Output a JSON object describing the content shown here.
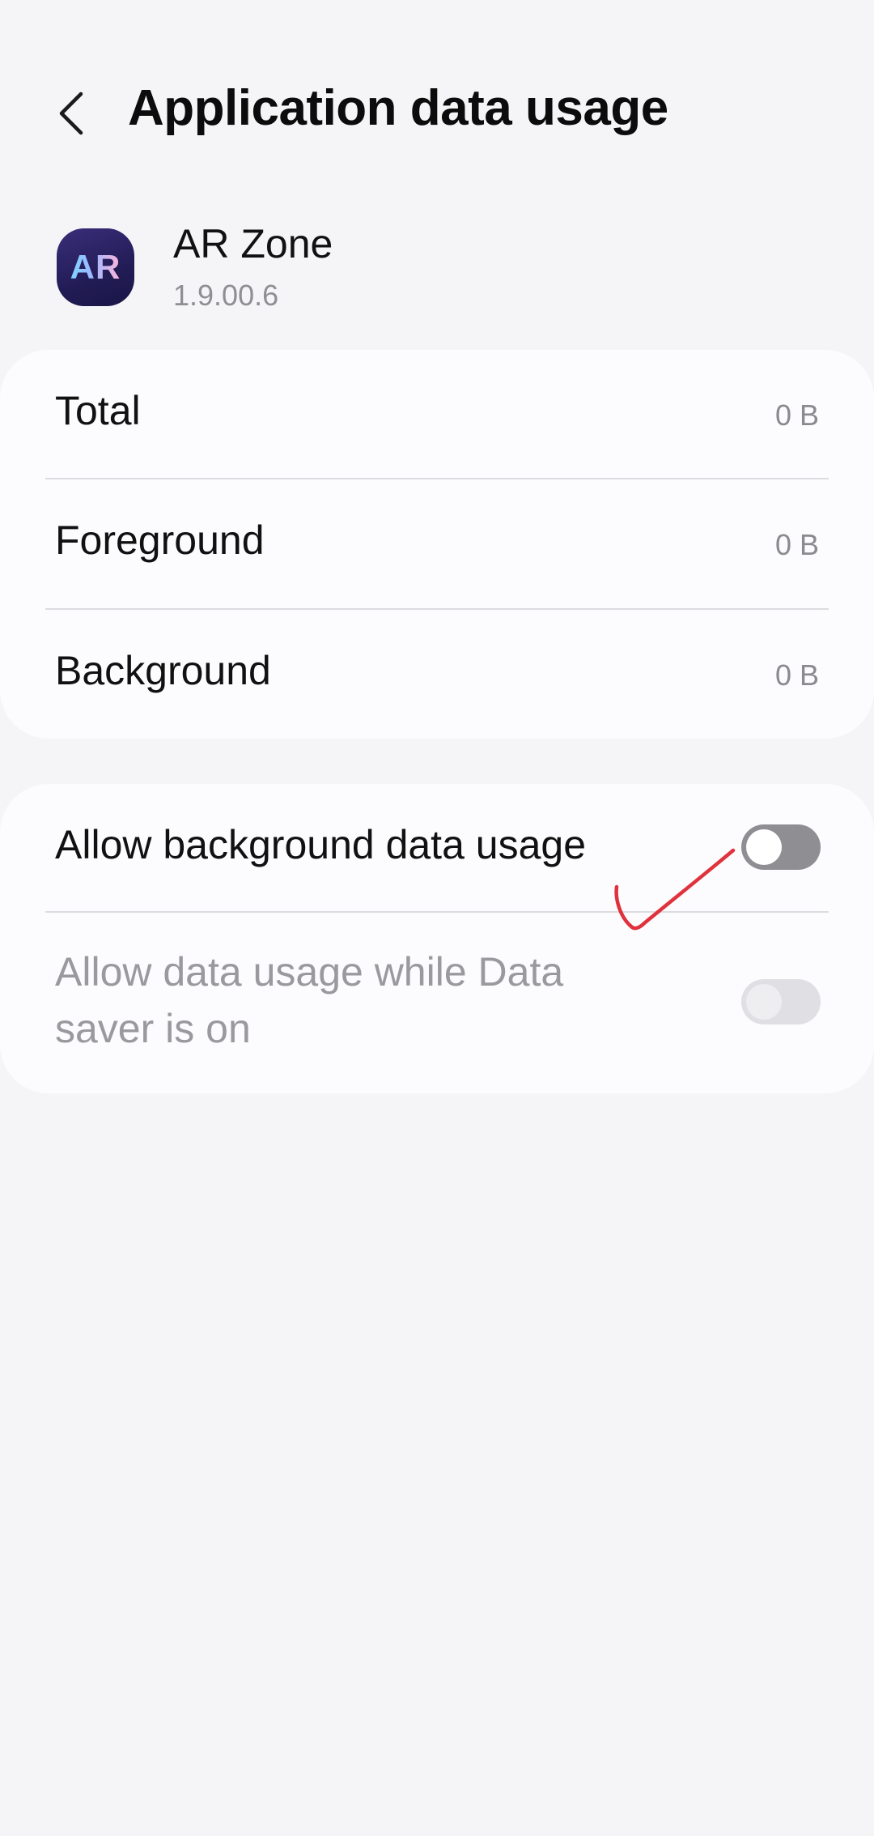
{
  "header": {
    "back_icon": "chevron-left-icon",
    "title": "Application data usage"
  },
  "app": {
    "icon_text": "AR",
    "name": "AR Zone",
    "version": "1.9.00.6"
  },
  "usage": {
    "rows": [
      {
        "label": "Total",
        "value": "0 B"
      },
      {
        "label": "Foreground",
        "value": "0 B"
      },
      {
        "label": "Background",
        "value": "0 B"
      }
    ]
  },
  "settings": {
    "background_data": {
      "label": "Allow background data usage",
      "enabled": false
    },
    "data_saver": {
      "label": "Allow data usage while Data saver is on",
      "label_line1": "Allow data usage while Data",
      "label_line2": "saver is on",
      "enabled": false,
      "disabled": true
    }
  },
  "colors": {
    "background": "#f5f5f8",
    "card": "#fcfcfe",
    "toggle_off": "#8e8e93",
    "toggle_disabled": "#e0e0e4",
    "annotation_mark": "#e0323c"
  }
}
